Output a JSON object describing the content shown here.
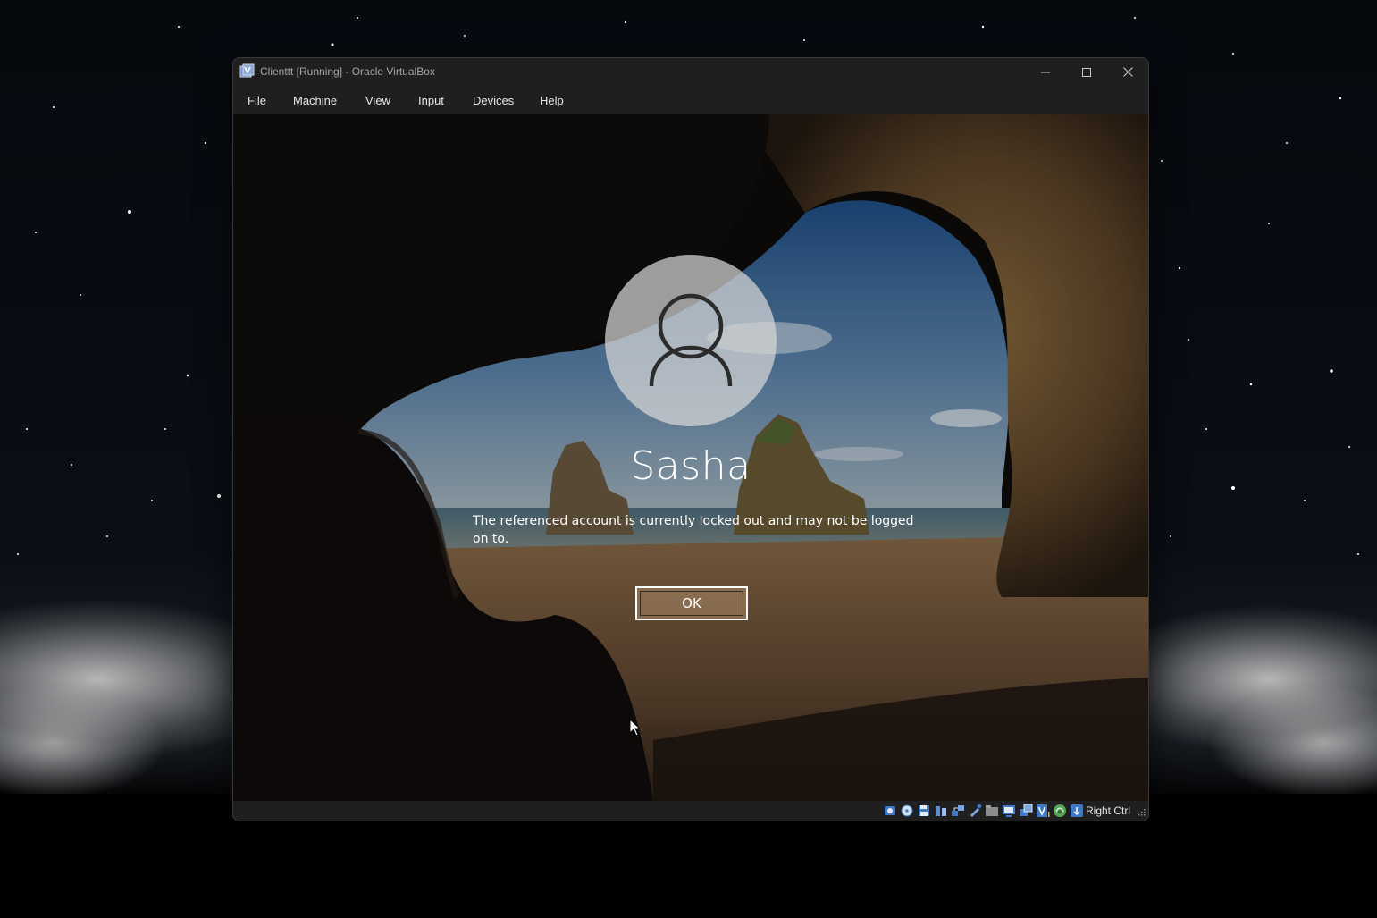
{
  "window": {
    "title": "Clienttt [Running] - Oracle VirtualBox",
    "icon": "virtualbox-icon",
    "controls": [
      "minimize-icon",
      "maximize-icon",
      "close-icon"
    ]
  },
  "menu": {
    "items": [
      "File",
      "Machine",
      "View",
      "Input",
      "Devices",
      "Help"
    ]
  },
  "lockscreen": {
    "user_name": "Sasha",
    "message": "The referenced account is currently locked out and may not be logged on to.",
    "ok_label": "OK"
  },
  "statusbar": {
    "host_key": "Right Ctrl",
    "icons": [
      "hard-disk-icon",
      "optical-drive-icon",
      "floppy-icon",
      "audio-icon",
      "network-icon",
      "usb-icon",
      "shared-folders-icon",
      "display-icon",
      "video-capture-icon",
      "virtualization-engine-icon",
      "recording-icon",
      "mouse-integration-icon"
    ]
  },
  "colors": {
    "window_bg": "#1f1f1f",
    "title_text": "#a6a6a6",
    "menu_text": "#e6e6e6",
    "button_fill": "#96785a"
  }
}
